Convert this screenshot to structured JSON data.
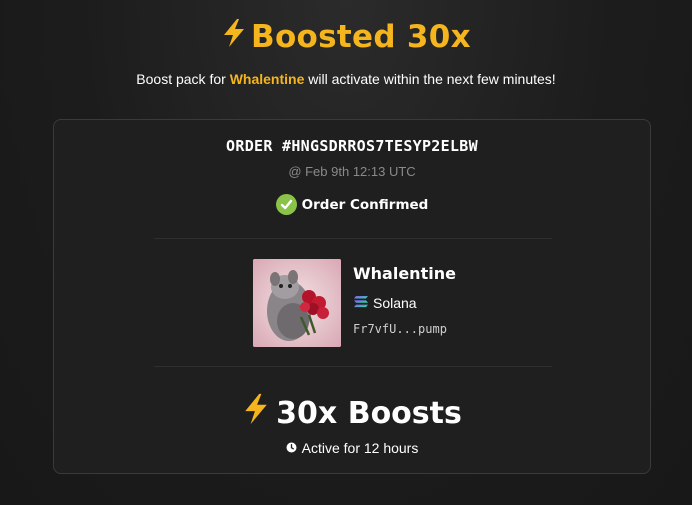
{
  "header": {
    "title": "Boosted 30x",
    "subtitle_prefix": "Boost pack for ",
    "subtitle_token": "Whalentine",
    "subtitle_suffix": " will activate within the next few minutes!"
  },
  "order": {
    "id_label": "ORDER #HNGSDRROS7TESYP2ELBW",
    "time": "@ Feb 9th 12:13 UTC",
    "status": "Order Confirmed"
  },
  "token": {
    "name": "Whalentine",
    "chain": "Solana",
    "address": "Fr7vfU...pump"
  },
  "boost": {
    "label": "30x Boosts",
    "duration": "Active for 12 hours"
  },
  "colors": {
    "accent": "#f5b51c",
    "confirmed": "#8bc34a",
    "background": "#1c1c1c",
    "card": "#1f1f1f"
  },
  "icons": [
    "lightning-bolt-icon",
    "check-circle-icon",
    "solana-icon",
    "clock-icon"
  ]
}
